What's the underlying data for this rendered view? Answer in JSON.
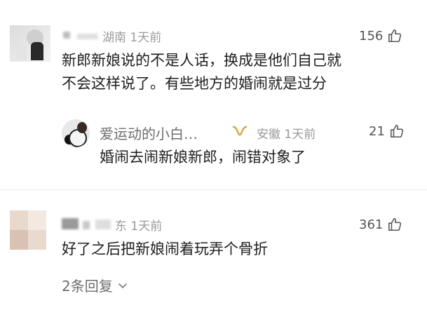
{
  "comments": [
    {
      "location_time": "湖南 1天前",
      "likes": "156",
      "text_line1": "新郎新娘说的不是人话，换成是他们自己就",
      "text_line2": "不会这样说了。有些地方的婚闹就是过分",
      "reply": {
        "username": "爱运动的小白…",
        "location_time": "安徽 1天前",
        "likes": "21",
        "text": "婚闹去闹新娘新郎，闹错对象了"
      }
    },
    {
      "location_time": "东 1天前",
      "likes": "361",
      "text": "好了之后把新娘闹着玩弄个骨折",
      "replies_link": "2条回复"
    }
  ],
  "colors": {
    "meta_gray": "#9a9a9a",
    "badge_gold": "#d9a53a"
  },
  "icons": [
    "thumbs-up-icon",
    "vip-badge-icon",
    "chevron-down-icon"
  ]
}
